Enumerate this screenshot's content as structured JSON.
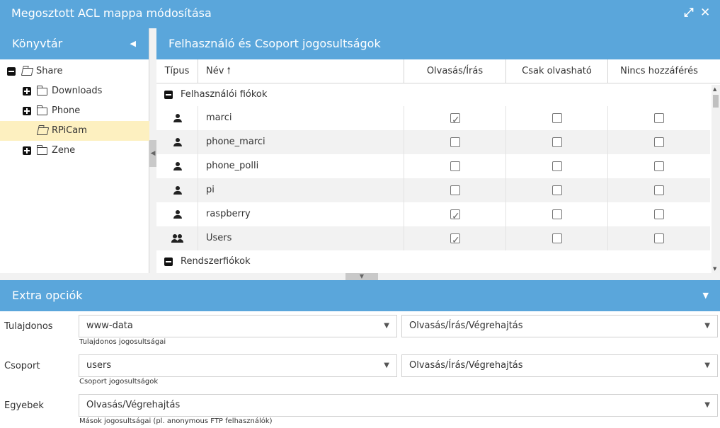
{
  "window": {
    "title": "Megosztott ACL mappa módosítása",
    "maximize_icon": "expand-arrows-icon",
    "close_icon": "close-x-icon"
  },
  "tree_panel": {
    "title": "Könyvtár",
    "items": [
      {
        "label": "Share",
        "toggle": "minus",
        "open": true,
        "selected": false
      },
      {
        "label": "Downloads",
        "toggle": "plus",
        "open": false,
        "selected": false
      },
      {
        "label": "Phone",
        "toggle": "plus",
        "open": false,
        "selected": false
      },
      {
        "label": "RPiCam",
        "toggle": "none",
        "open": true,
        "selected": true
      },
      {
        "label": "Zene",
        "toggle": "plus",
        "open": false,
        "selected": false
      }
    ]
  },
  "permissions_panel": {
    "title": "Felhasználó és Csoport jogosultságok",
    "columns": {
      "type": "Típus",
      "name": "Név",
      "read_write": "Olvasás/Írás",
      "read_only": "Csak olvasható",
      "no_access": "Nincs hozzáférés"
    },
    "groups": [
      {
        "label": "Felhasználói fiókok",
        "rows": [
          {
            "kind": "user",
            "name": "marci",
            "read_write": true,
            "read_only": false,
            "no_access": false
          },
          {
            "kind": "user",
            "name": "phone_marci",
            "read_write": false,
            "read_only": false,
            "no_access": false
          },
          {
            "kind": "user",
            "name": "phone_polli",
            "read_write": false,
            "read_only": false,
            "no_access": false
          },
          {
            "kind": "user",
            "name": "pi",
            "read_write": false,
            "read_only": false,
            "no_access": false
          },
          {
            "kind": "user",
            "name": "raspberry",
            "read_write": true,
            "read_only": false,
            "no_access": false
          },
          {
            "kind": "group",
            "name": "Users",
            "read_write": true,
            "read_only": false,
            "no_access": false
          }
        ]
      },
      {
        "label": "Rendszerfiókok",
        "rows": []
      }
    ]
  },
  "extra_options": {
    "title": "Extra opciók",
    "owner": {
      "label": "Tulajdonos",
      "value": "www-data",
      "permission": "Olvasás/Írás/Végrehajtás",
      "hint": "Tulajdonos jogosultságai"
    },
    "group": {
      "label": "Csoport",
      "value": "users",
      "permission": "Olvasás/Írás/Végrehajtás",
      "hint": "Csoport jogosultságok"
    },
    "others": {
      "label": "Egyebek",
      "permission": "Olvasás/Végrehajtás",
      "hint": "Mások jogosultságai (pl. anonymous FTP felhasználók)"
    }
  }
}
